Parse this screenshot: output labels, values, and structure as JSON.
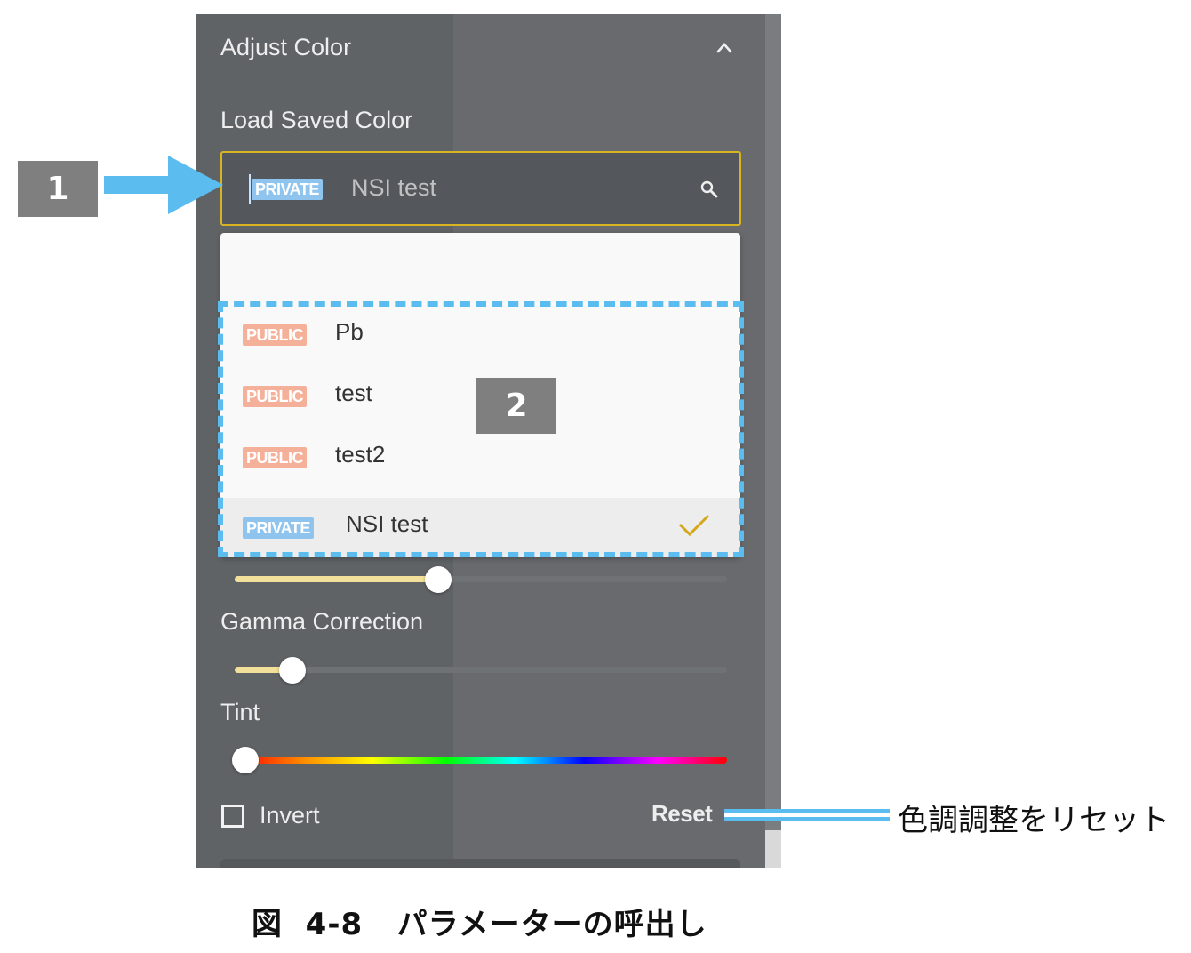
{
  "panel": {
    "title": "Adjust Color",
    "collapse_icon": "chevron-up-icon",
    "load_saved_label": "Load Saved Color",
    "search": {
      "tag": "PRIVATE",
      "value": "NSI test",
      "icon": "search-icon"
    },
    "dropdown": {
      "items": [
        {
          "tag": "PUBLIC",
          "label": "Pb",
          "selected": false
        },
        {
          "tag": "PUBLIC",
          "label": "test",
          "selected": false
        },
        {
          "tag": "PUBLIC",
          "label": "test2",
          "selected": false
        },
        {
          "tag": "PRIVATE",
          "label": "NSI test",
          "selected": true
        }
      ]
    },
    "sliders": [
      {
        "name": "hidden-slider",
        "value_fraction": 0.41
      },
      {
        "name": "gamma",
        "label": "Gamma Correction",
        "value_fraction": 0.1
      },
      {
        "name": "tint",
        "label": "Tint",
        "value_fraction": 0.0
      }
    ],
    "invert_label": "Invert",
    "invert_checked": false,
    "reset_label": "Reset"
  },
  "annotations": {
    "badge_1": "1",
    "badge_2": "2",
    "reset_note": "色調調整をリセット"
  },
  "caption": "図  4-8   パラメーターの呼出し",
  "colors": {
    "panel_bg": "#606366",
    "accent_border": "#d8b520",
    "private_tag": "#8ec4ee",
    "public_tag": "#f5b09a",
    "slider_fill": "#f3e09a",
    "highlight": "#5bbcf0",
    "badge": "#7f7f7f"
  }
}
